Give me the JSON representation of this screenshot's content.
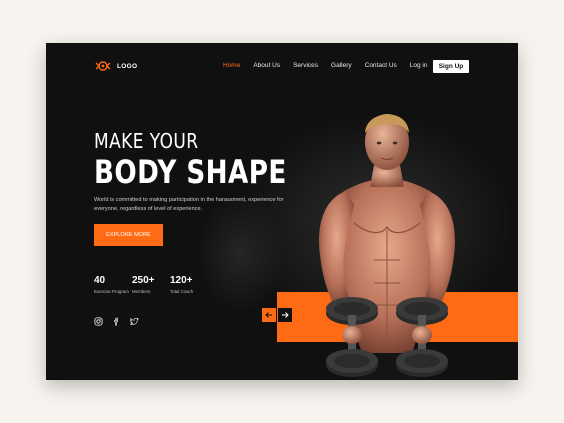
{
  "brand": {
    "logo_text": "LOGO",
    "accent_color": "#ff6a14"
  },
  "nav": {
    "items": [
      {
        "label": "Home",
        "active": true
      },
      {
        "label": "About Us"
      },
      {
        "label": "Services"
      },
      {
        "label": "Gallery"
      },
      {
        "label": "Contact Us"
      },
      {
        "label": "Log in"
      }
    ],
    "signup_label": "Sign Up"
  },
  "hero": {
    "line1": "MAKE YOUR",
    "line2": "BODY SHAPE",
    "description": "World is committed to making participation in the harassment, experience for everyone, regardless of level of experience.",
    "cta_label": "EXPLORE MORE"
  },
  "stats": [
    {
      "number": "40",
      "label": "Exercise Program"
    },
    {
      "number": "250+",
      "label": "Members"
    },
    {
      "number": "120+",
      "label": "Total Coach"
    }
  ],
  "social": {
    "icons": [
      "instagram-icon",
      "facebook-icon",
      "twitter-icon"
    ]
  },
  "slider": {
    "prev_icon": "arrow-left-icon",
    "next_icon": "arrow-right-icon"
  }
}
